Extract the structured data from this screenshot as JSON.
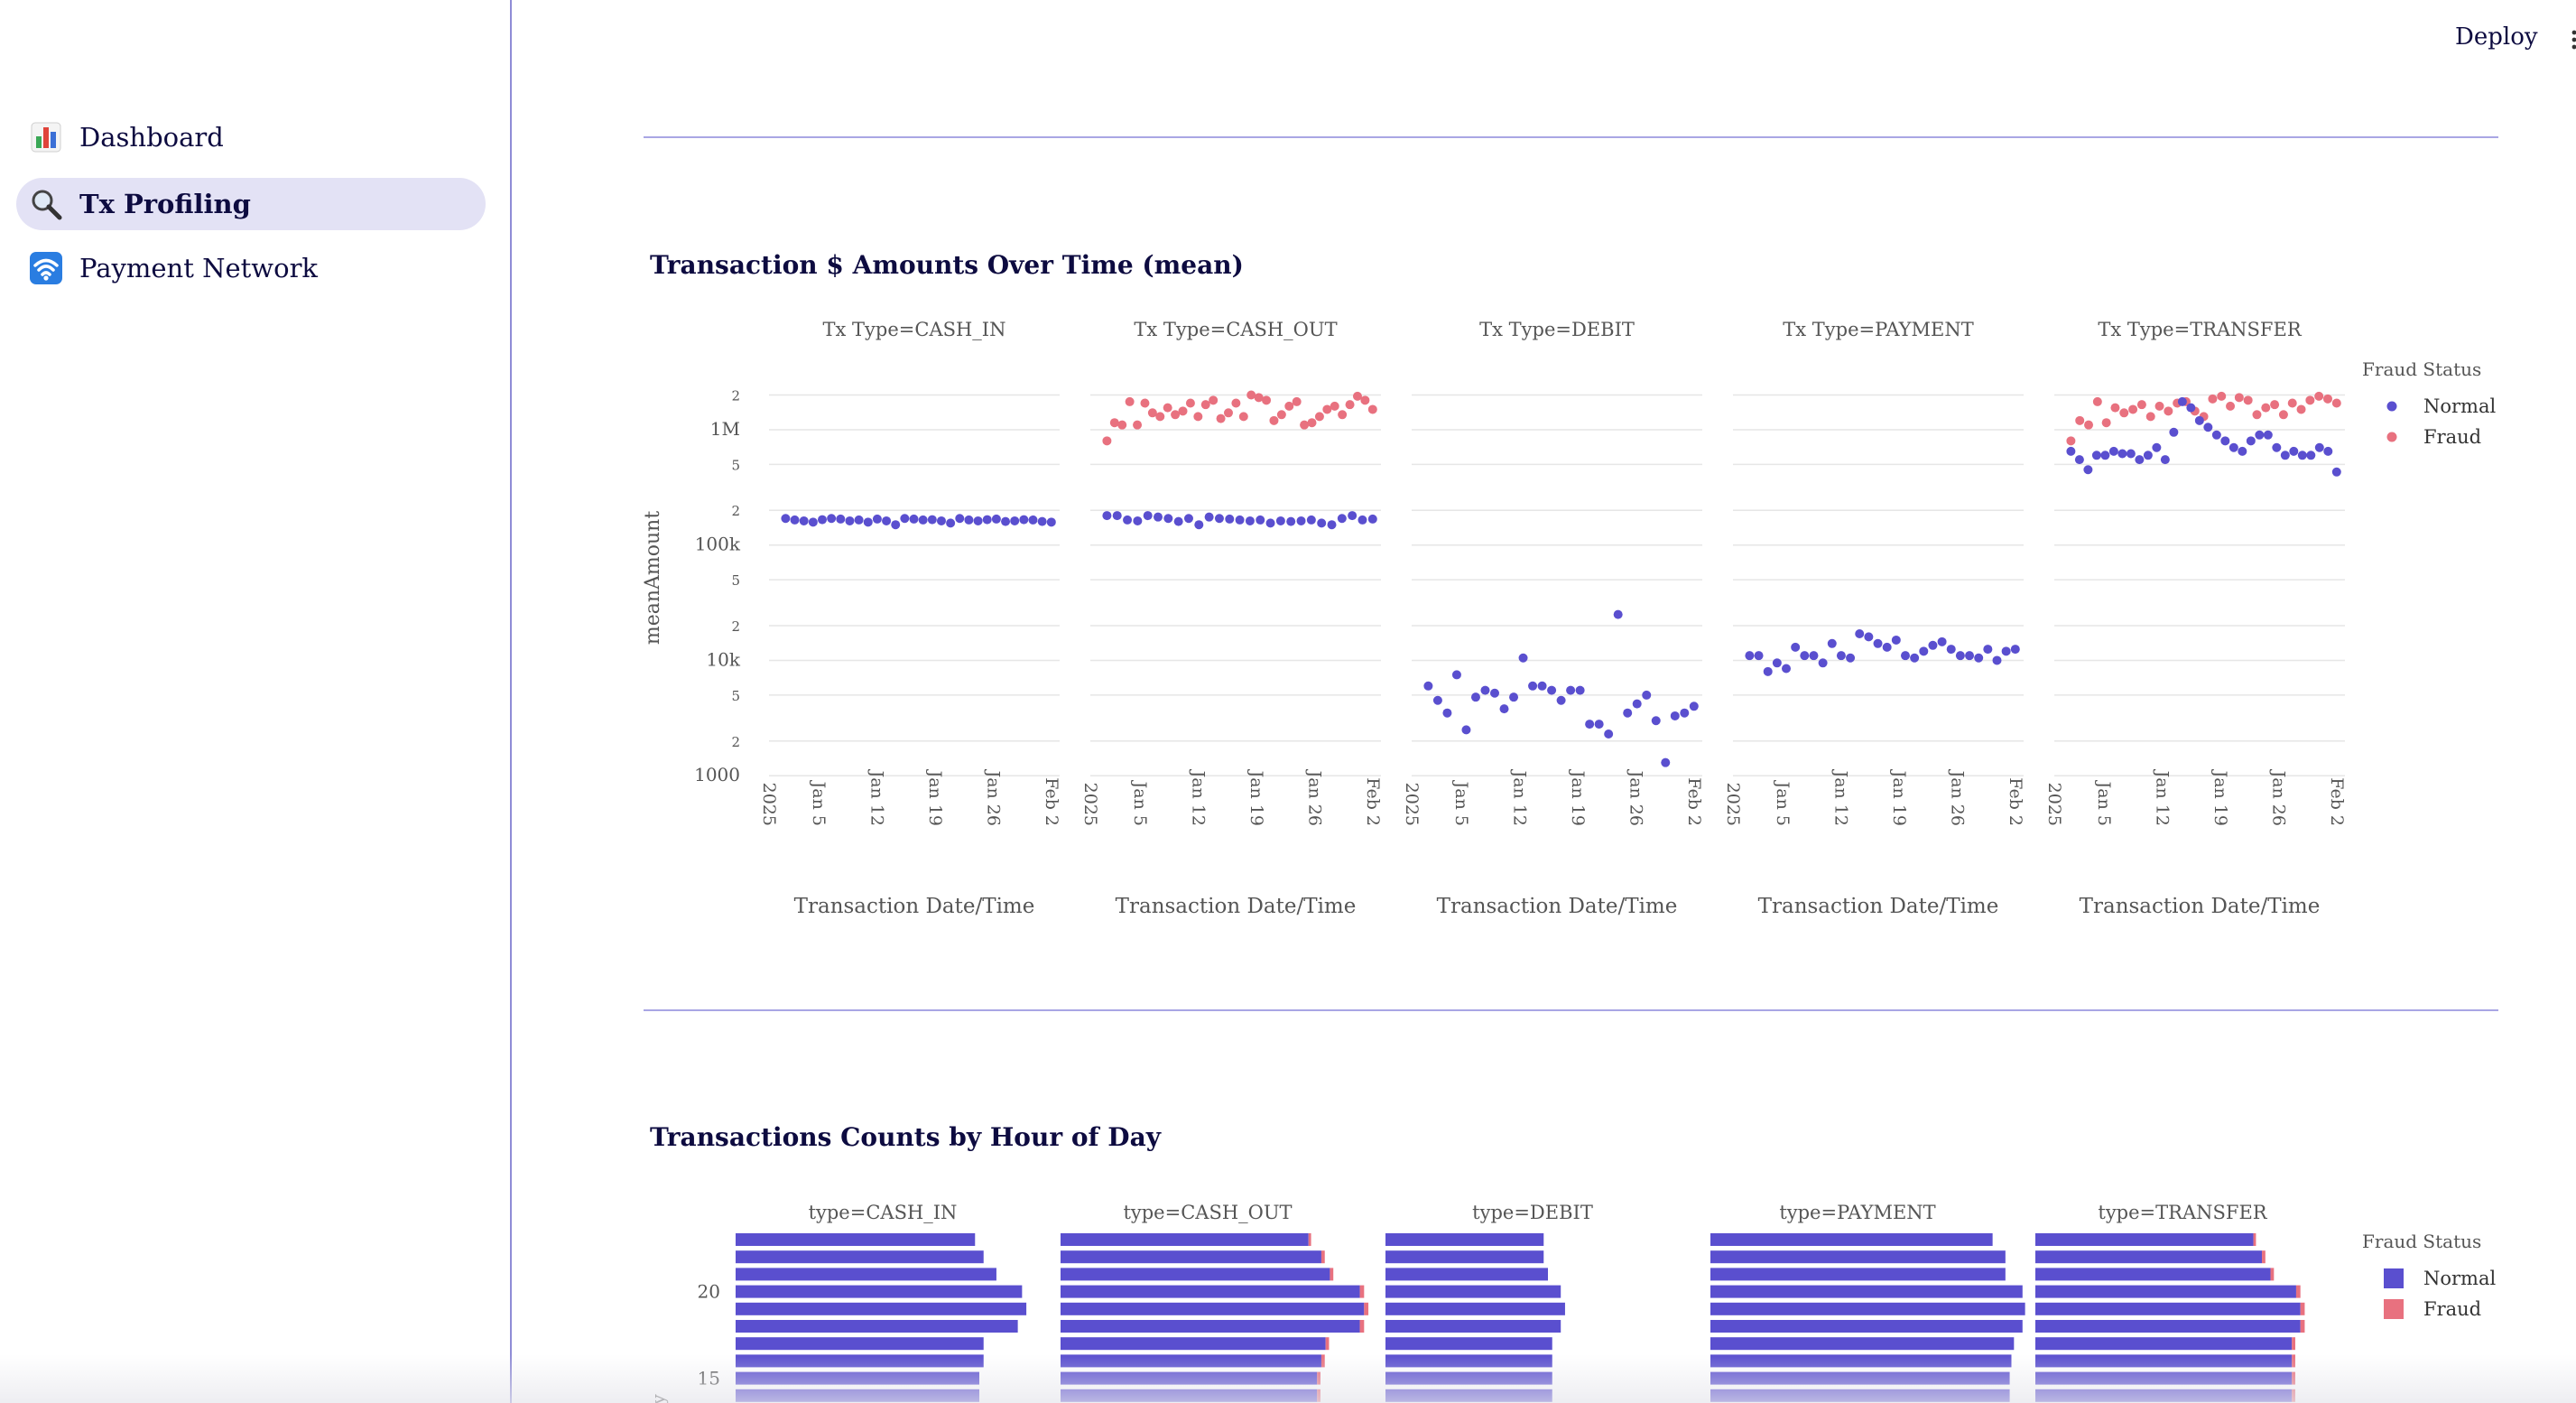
{
  "sidebar": {
    "items": [
      {
        "label": "Dashboard",
        "icon": "bar-chart-icon"
      },
      {
        "label": "Tx Profiling",
        "icon": "magnifier-icon",
        "active": true
      },
      {
        "label": "Payment Network",
        "icon": "wifi-icon"
      }
    ]
  },
  "header": {
    "deploy_label": "Deploy"
  },
  "colors": {
    "normal": "#5a4fcf",
    "fraud": "#e8717f",
    "accent": "#8f8cd6",
    "active_bg": "#e3e2f5"
  },
  "sections": {
    "amounts_title": "Transaction $ Amounts Over Time (mean)",
    "counts_title": "Transactions Counts by Hour of Day"
  },
  "chart_data": [
    {
      "type": "scatter",
      "title": "Transaction $ Amounts Over Time (mean)",
      "ylabel": "meanAmount",
      "xlabel": "Transaction Date/Time",
      "y_scale": "log",
      "ylim": [
        700,
        3000000
      ],
      "xlim": [
        "2024-12-30",
        "2025-02-03"
      ],
      "y_ticks": [
        {
          "v": 1000,
          "label": "1000"
        },
        {
          "v": 2000,
          "label": "2"
        },
        {
          "v": 5000,
          "label": "5"
        },
        {
          "v": 10000,
          "label": "10k"
        },
        {
          "v": 20000,
          "label": "2"
        },
        {
          "v": 50000,
          "label": "5"
        },
        {
          "v": 100000,
          "label": "100k"
        },
        {
          "v": 200000,
          "label": "2"
        },
        {
          "v": 500000,
          "label": "5"
        },
        {
          "v": 1000000,
          "label": "1M"
        },
        {
          "v": 2000000,
          "label": "2"
        }
      ],
      "x_ticks": [
        {
          "date": "2024-12-30",
          "label": "2025"
        },
        {
          "date": "2025-01-05",
          "label": "Jan 5"
        },
        {
          "date": "2025-01-12",
          "label": "Jan 12"
        },
        {
          "date": "2025-01-19",
          "label": "Jan 19"
        },
        {
          "date": "2025-01-26",
          "label": "Jan 26"
        },
        {
          "date": "2025-02-02",
          "label": "Feb 2"
        }
      ],
      "legend": {
        "title": "Fraud Status",
        "position": "right",
        "entries": [
          "Normal",
          "Fraud"
        ]
      },
      "first_date": "2025-01-01",
      "facets": [
        {
          "title": "Tx Type=CASH_IN",
          "series": [
            {
              "name": "Normal",
              "values": [
                170000,
                165000,
                162000,
                158000,
                166000,
                170000,
                168000,
                162000,
                165000,
                158000,
                168000,
                162000,
                150000,
                170000,
                168000,
                165000,
                166000,
                162000,
                155000,
                170000,
                165000,
                162000,
                166000,
                168000,
                160000,
                162000,
                166000,
                165000,
                160000,
                158000
              ]
            }
          ]
        },
        {
          "title": "Tx Type=CASH_OUT",
          "series": [
            {
              "name": "Normal",
              "values": [
                180000,
                180000,
                165000,
                162000,
                180000,
                175000,
                170000,
                160000,
                170000,
                150000,
                175000,
                170000,
                168000,
                165000,
                162000,
                165000,
                155000,
                162000,
                160000,
                162000,
                165000,
                155000,
                150000,
                170000,
                180000,
                165000,
                168000
              ]
            },
            {
              "name": "Fraud",
              "values": [
                800000,
                1150000,
                1100000,
                1750000,
                1100000,
                1700000,
                1400000,
                1300000,
                1550000,
                1350000,
                1450000,
                1700000,
                1300000,
                1650000,
                1800000,
                1250000,
                1400000,
                1700000,
                1300000,
                2000000,
                1900000,
                1800000,
                1200000,
                1350000,
                1600000,
                1750000,
                1100000,
                1150000,
                1300000,
                1500000,
                1600000,
                1350000,
                1650000,
                1950000,
                1800000,
                1500000
              ]
            }
          ]
        },
        {
          "title": "Tx Type=DEBIT",
          "series": [
            {
              "name": "Normal",
              "values": [
                6000,
                4500,
                3500,
                7500,
                2500,
                4800,
                5500,
                5200,
                3800,
                4800,
                10500,
                6000,
                6000,
                5500,
                4500,
                5500,
                5500,
                2800,
                2800,
                2300,
                25000,
                3500,
                4200,
                5000,
                3000,
                1300,
                3300,
                3500,
                4000
              ]
            }
          ]
        },
        {
          "title": "Tx Type=PAYMENT",
          "series": [
            {
              "name": "Normal",
              "values": [
                11000,
                11000,
                8000,
                9500,
                8500,
                13000,
                11000,
                11000,
                9500,
                14000,
                11000,
                10500,
                17000,
                16000,
                14000,
                13000,
                15000,
                11000,
                10500,
                12000,
                13500,
                14500,
                12500,
                11000,
                11000,
                10500,
                12500,
                10000,
                12000,
                12500
              ]
            }
          ]
        },
        {
          "title": "Tx Type=TRANSFER",
          "series": [
            {
              "name": "Normal",
              "values": [
                650000,
                550000,
                450000,
                600000,
                600000,
                650000,
                620000,
                620000,
                550000,
                600000,
                700000,
                550000,
                950000,
                1750000,
                1550000,
                1200000,
                1050000,
                900000,
                800000,
                700000,
                650000,
                800000,
                900000,
                900000,
                700000,
                600000,
                650000,
                600000,
                600000,
                700000,
                650000,
                430000
              ]
            },
            {
              "name": "Fraud",
              "values": [
                800000,
                1200000,
                1100000,
                1750000,
                1150000,
                1550000,
                1400000,
                1500000,
                1650000,
                1300000,
                1600000,
                1450000,
                1700000,
                1750000,
                1450000,
                1300000,
                1850000,
                1950000,
                1600000,
                1900000,
                1800000,
                1350000,
                1550000,
                1650000,
                1350000,
                1700000,
                1500000,
                1800000,
                1950000,
                1850000,
                1700000
              ]
            }
          ]
        }
      ]
    },
    {
      "type": "bar",
      "orientation": "horizontal",
      "stacked": true,
      "title": "Transactions Counts by Hour of Day",
      "ylabel": "y",
      "y_ticks": [
        {
          "v": 20,
          "label": "20"
        },
        {
          "v": 15,
          "label": "15"
        }
      ],
      "legend": {
        "title": "Fraud Status",
        "position": "right",
        "entries": [
          "Normal",
          "Fraud"
        ]
      },
      "hours_visible": [
        23,
        22,
        21,
        20,
        19,
        18,
        17,
        16,
        15,
        14
      ],
      "facets": [
        {
          "title": "type=CASH_IN",
          "series": [
            {
              "name": "Normal",
              "values": [
                280,
                290,
                305,
                335,
                340,
                330,
                290,
                290,
                285,
                285
              ]
            },
            {
              "name": "Fraud",
              "values": [
                0,
                0,
                0,
                0,
                0,
                0,
                0,
                0,
                0,
                0
              ]
            }
          ]
        },
        {
          "title": "type=CASH_OUT",
          "series": [
            {
              "name": "Normal",
              "values": [
                290,
                305,
                315,
                350,
                355,
                350,
                310,
                305,
                300,
                300
              ]
            },
            {
              "name": "Fraud",
              "values": [
                3,
                4,
                4,
                5,
                5,
                5,
                4,
                4,
                4,
                4
              ]
            }
          ]
        },
        {
          "title": "type=DEBIT",
          "series": [
            {
              "name": "Normal",
              "values": [
                185,
                185,
                190,
                205,
                210,
                205,
                195,
                195,
                195,
                195
              ]
            },
            {
              "name": "Fraud",
              "values": [
                0,
                0,
                0,
                0,
                0,
                0,
                0,
                0,
                0,
                0
              ]
            }
          ]
        },
        {
          "title": "type=PAYMENT",
          "series": [
            {
              "name": "Normal",
              "values": [
                330,
                345,
                345,
                365,
                368,
                365,
                355,
                352,
                350,
                350
              ]
            },
            {
              "name": "Fraud",
              "values": [
                0,
                0,
                0,
                0,
                0,
                0,
                0,
                0,
                0,
                0
              ]
            }
          ]
        },
        {
          "title": "type=TRANSFER",
          "series": [
            {
              "name": "Normal",
              "values": [
                255,
                265,
                275,
                305,
                310,
                310,
                300,
                300,
                300,
                300
              ]
            },
            {
              "name": "Fraud",
              "values": [
                3,
                4,
                4,
                5,
                5,
                5,
                4,
                4,
                4,
                4
              ]
            }
          ]
        }
      ]
    }
  ]
}
